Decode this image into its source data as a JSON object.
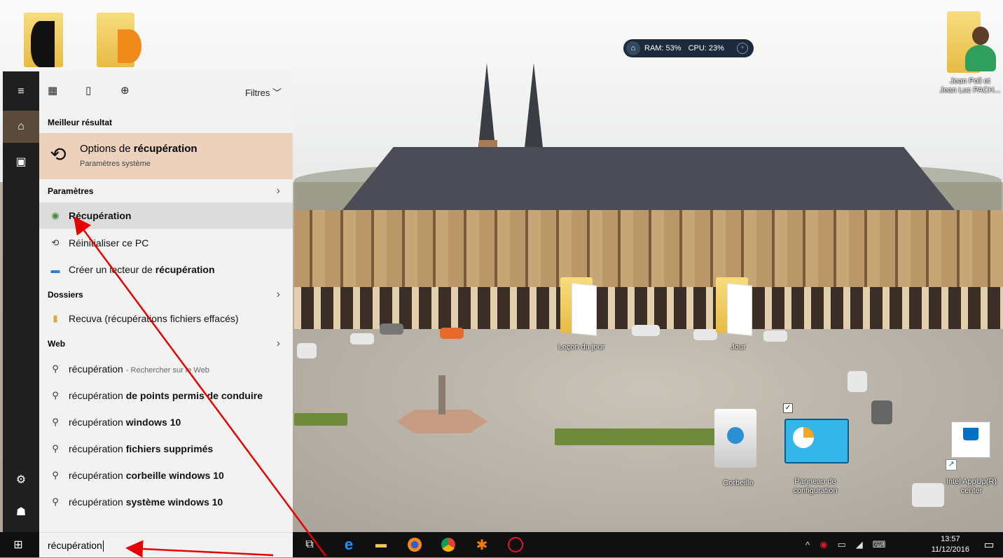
{
  "desktop": {
    "icons": [
      {
        "label": "Jean Poll et Jean Luc PACH...",
        "line1": "Jean Poll et",
        "line2": "Jean Luc PACH..."
      },
      {
        "label": "Leçon du jour"
      },
      {
        "label": "Jour"
      },
      {
        "label": "Corbeille"
      },
      {
        "label": "Panneau de configuration",
        "line1": "Panneau de",
        "line2": "configuration"
      },
      {
        "label": "Intel AppUp(R) center",
        "line1": "Intel AppUp(R)",
        "line2": "center"
      }
    ]
  },
  "perf_widget": {
    "ram": "RAM: 53%",
    "cpu": "CPU: 23%"
  },
  "search_panel": {
    "filters_label": "Filtres",
    "best_match": {
      "header": "Meilleur résultat",
      "title_prefix": "Options de ",
      "title_bold": "récupération",
      "subtitle": "Paramètres système"
    },
    "settings": {
      "header": "Paramètres",
      "items": [
        {
          "prefix": "",
          "bold": "Récupération",
          "suffix": ""
        },
        {
          "prefix": "Réinitialiser ce PC",
          "bold": "",
          "suffix": ""
        },
        {
          "prefix": "Créer un lecteur de ",
          "bold": "récupération",
          "suffix": ""
        }
      ]
    },
    "folders": {
      "header": "Dossiers",
      "items": [
        {
          "prefix": "Recuva (récupérations fichiers effacés)"
        }
      ]
    },
    "web": {
      "header": "Web",
      "items": [
        {
          "prefix": "récupération",
          "muted": "- Rechercher sur le Web",
          "bold": ""
        },
        {
          "prefix": "récupération ",
          "bold": "de points permis de conduire"
        },
        {
          "prefix": "récupération ",
          "bold": "windows 10"
        },
        {
          "prefix": "récupération ",
          "bold": "fichiers supprimés"
        },
        {
          "prefix": "récupération ",
          "bold": "corbeille windows 10"
        },
        {
          "prefix": "récupération ",
          "bold": "système windows 10"
        }
      ]
    },
    "query": "récupération"
  },
  "taskbar": {
    "time": "13:57",
    "date": "11/12/2016"
  },
  "colors": {
    "best_match_bg": "#ecd2bc",
    "rail_bg": "#1f1f1f",
    "taskbar_bg": "#101010",
    "arrow": "#e60000"
  }
}
